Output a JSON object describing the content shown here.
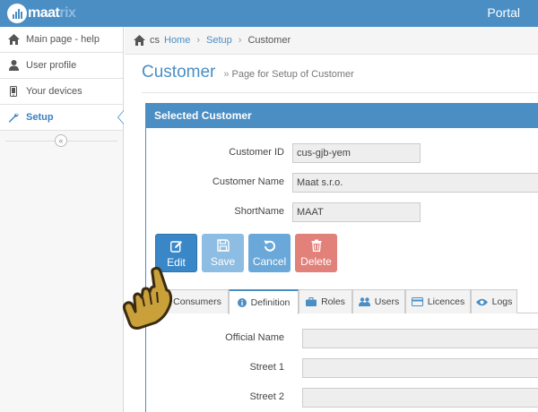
{
  "header": {
    "logo_prefix": "maat",
    "logo_suffix": "rix",
    "portal_label": "Portal"
  },
  "sidebar": {
    "items": [
      {
        "label": "Main page - help",
        "icon": "home-icon"
      },
      {
        "label": "User profile",
        "icon": "user-icon"
      },
      {
        "label": "Your devices",
        "icon": "mobile-icon"
      },
      {
        "label": "Setup",
        "icon": "wrench-icon",
        "active": true
      }
    ],
    "collapse_glyph": "«"
  },
  "breadcrumb": {
    "root": "cs",
    "items": [
      "Home",
      "Setup"
    ],
    "current": "Customer"
  },
  "page": {
    "title": "Customer",
    "subtitle_marker": "»",
    "subtitle": "Page for Setup of Customer"
  },
  "panel": {
    "title": "Selected Customer",
    "fields": [
      {
        "label": "Customer ID",
        "value": "cus-gjb-yem"
      },
      {
        "label": "Customer Name",
        "value": "Maat s.r.o."
      },
      {
        "label": "ShortName",
        "value": "MAAT"
      }
    ],
    "buttons": {
      "edit": "Edit",
      "save": "Save",
      "cancel": "Cancel",
      "delete": "Delete"
    },
    "tabs": [
      {
        "label": "Consumers",
        "icon": "users-icon"
      },
      {
        "label": "Definition",
        "icon": "info-icon",
        "active": true
      },
      {
        "label": "Roles",
        "icon": "briefcase-icon"
      },
      {
        "label": "Users",
        "icon": "users-icon"
      },
      {
        "label": "Licences",
        "icon": "card-icon"
      },
      {
        "label": "Logs",
        "icon": "eye-icon"
      }
    ],
    "definition_fields": [
      {
        "label": "Official Name",
        "value": ""
      },
      {
        "label": "Street 1",
        "value": ""
      },
      {
        "label": "Street 2",
        "value": ""
      }
    ]
  },
  "colors": {
    "brand": "#4a8ec4",
    "edit": "#3a87c8",
    "save": "#8dbde3",
    "cancel": "#6aa8d9",
    "delete": "#e2807a"
  }
}
